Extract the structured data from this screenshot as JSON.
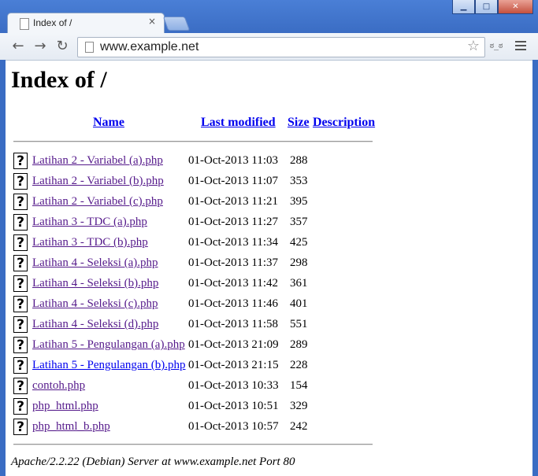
{
  "browser": {
    "tab_title": "Index of /",
    "url": "www.example.net",
    "min_glyph": "▁",
    "max_glyph": "□",
    "close_glyph": "✕",
    "tab_close_glyph": "×",
    "back_glyph": "←",
    "forward_glyph": "→",
    "reload_glyph": "↻",
    "star_glyph": "☆",
    "ext_glyph": "ಠ_ಠ"
  },
  "page": {
    "title": "Index of /",
    "columns": {
      "name": "Name",
      "modified": "Last modified",
      "size": "Size",
      "description": "Description"
    },
    "file_icon_glyph": "?",
    "files": [
      {
        "name": "Latihan 2 - Variabel (a).php",
        "modified": "01-Oct-2013 11:03",
        "size": "288",
        "visited": true
      },
      {
        "name": "Latihan 2 - Variabel (b).php",
        "modified": "01-Oct-2013 11:07",
        "size": "353",
        "visited": true
      },
      {
        "name": "Latihan 2 - Variabel (c).php",
        "modified": "01-Oct-2013 11:21",
        "size": "395",
        "visited": true
      },
      {
        "name": "Latihan 3 - TDC (a).php",
        "modified": "01-Oct-2013 11:27",
        "size": "357",
        "visited": true
      },
      {
        "name": "Latihan 3 - TDC (b).php",
        "modified": "01-Oct-2013 11:34",
        "size": "425",
        "visited": true
      },
      {
        "name": "Latihan 4 - Seleksi (a).php",
        "modified": "01-Oct-2013 11:37",
        "size": "298",
        "visited": true
      },
      {
        "name": "Latihan 4 - Seleksi (b).php",
        "modified": "01-Oct-2013 11:42",
        "size": "361",
        "visited": true
      },
      {
        "name": "Latihan 4 - Seleksi (c).php",
        "modified": "01-Oct-2013 11:46",
        "size": "401",
        "visited": true
      },
      {
        "name": "Latihan 4 - Seleksi (d).php",
        "modified": "01-Oct-2013 11:58",
        "size": "551",
        "visited": true
      },
      {
        "name": "Latihan 5 - Pengulangan (a).php",
        "modified": "01-Oct-2013 21:09",
        "size": "289",
        "visited": true
      },
      {
        "name": "Latihan 5 - Pengulangan (b).php",
        "modified": "01-Oct-2013 21:15",
        "size": "228",
        "visited": false
      },
      {
        "name": "contoh.php",
        "modified": "01-Oct-2013 10:33",
        "size": "154",
        "visited": true
      },
      {
        "name": "php_html.php",
        "modified": "01-Oct-2013 10:51",
        "size": "329",
        "visited": true
      },
      {
        "name": "php_html_b.php",
        "modified": "01-Oct-2013 10:57",
        "size": "242",
        "visited": true
      }
    ],
    "server_signature": "Apache/2.2.22 (Debian) Server at www.example.net Port 80"
  },
  "colors": {
    "link_unvisited": "#0000ee",
    "link_visited": "#551a8b",
    "titlebar": "#3a6cc3"
  }
}
